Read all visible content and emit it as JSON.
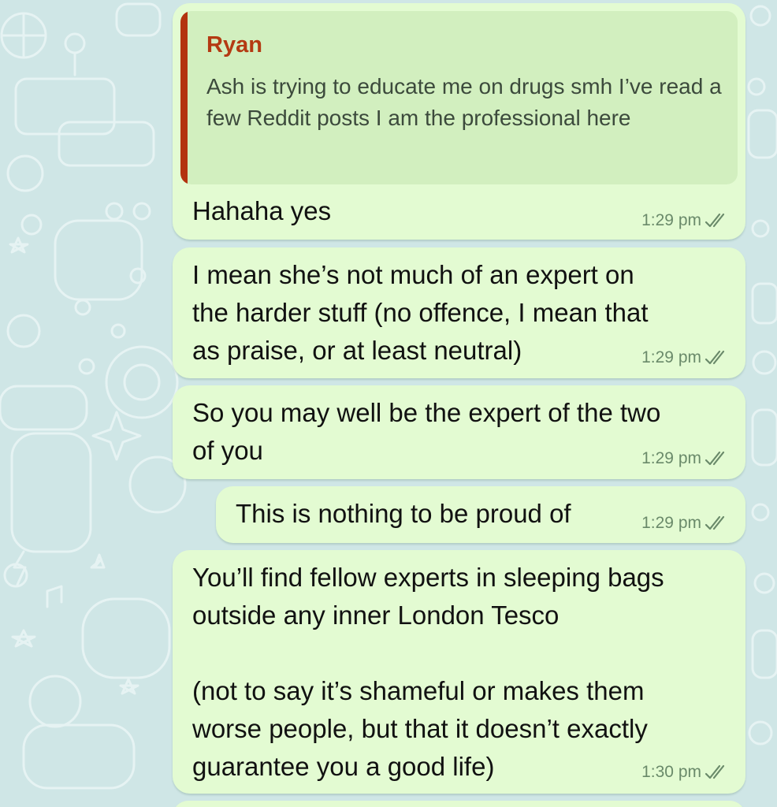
{
  "messages": [
    {
      "reply_to": {
        "author": "Ryan",
        "text": "Ash is trying to educate me on drugs smh I’ve read a few Reddit posts I am the professional here"
      },
      "text": "Hahaha yes",
      "time": "1:29 pm",
      "status_icon": "double-check-icon"
    },
    {
      "text": "I mean she’s not much of an expert on\nthe harder stuff (no offence, I mean that\nas praise, or at least neutral)",
      "time": "1:29 pm",
      "status_icon": "double-check-icon"
    },
    {
      "text": "So you may well be the expert of the two\nof you",
      "time": "1:29 pm",
      "status_icon": "double-check-icon"
    },
    {
      "text": "This is nothing to be proud of",
      "time": "1:29 pm",
      "status_icon": "double-check-icon"
    },
    {
      "text": "You’ll find fellow experts in sleeping bags\noutside any inner London Tesco\n\n(not to say it’s shameful or makes them\nworse people, but that it doesn’t exactly\nguarantee you a good life)",
      "time": "1:30 pm",
      "status_icon": "double-check-icon"
    }
  ],
  "colors": {
    "background": "#cfe6e6",
    "bubble": "#e3fbd2",
    "reply_accent": "#b3330f",
    "reply_box": "#d2efbf"
  }
}
